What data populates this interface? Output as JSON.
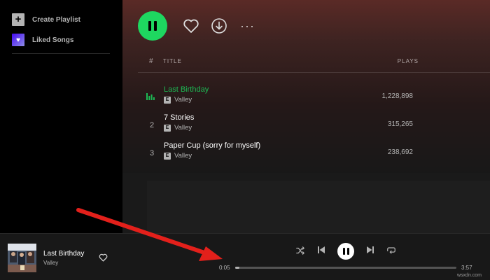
{
  "sidebar": {
    "items": [
      {
        "label": "Create Playlist",
        "icon": "plus-icon"
      },
      {
        "label": "Liked Songs",
        "icon": "heart-icon"
      }
    ]
  },
  "playlist": {
    "header": {
      "hash": "#",
      "title": "TITLE",
      "plays": "PLAYS"
    },
    "tracks": [
      {
        "num": "",
        "title": "Last Birthday",
        "artist": "Valley",
        "explicit": "E",
        "plays": "1,228,898",
        "playing": true
      },
      {
        "num": "2",
        "title": "7 Stories",
        "artist": "Valley",
        "explicit": "E",
        "plays": "315,265",
        "playing": false
      },
      {
        "num": "3",
        "title": "Paper Cup (sorry for myself)",
        "artist": "Valley",
        "explicit": "E",
        "plays": "238,692",
        "playing": false
      }
    ],
    "more_label": "···"
  },
  "player": {
    "title": "Last Birthday",
    "artist": "Valley",
    "elapsed": "0:05",
    "duration": "3:57",
    "progress": 0.02
  },
  "colors": {
    "accent": "#1ed760",
    "active_track": "#1db954",
    "annotation_arrow": "#e3201b"
  },
  "watermark": "wsxdn.com"
}
